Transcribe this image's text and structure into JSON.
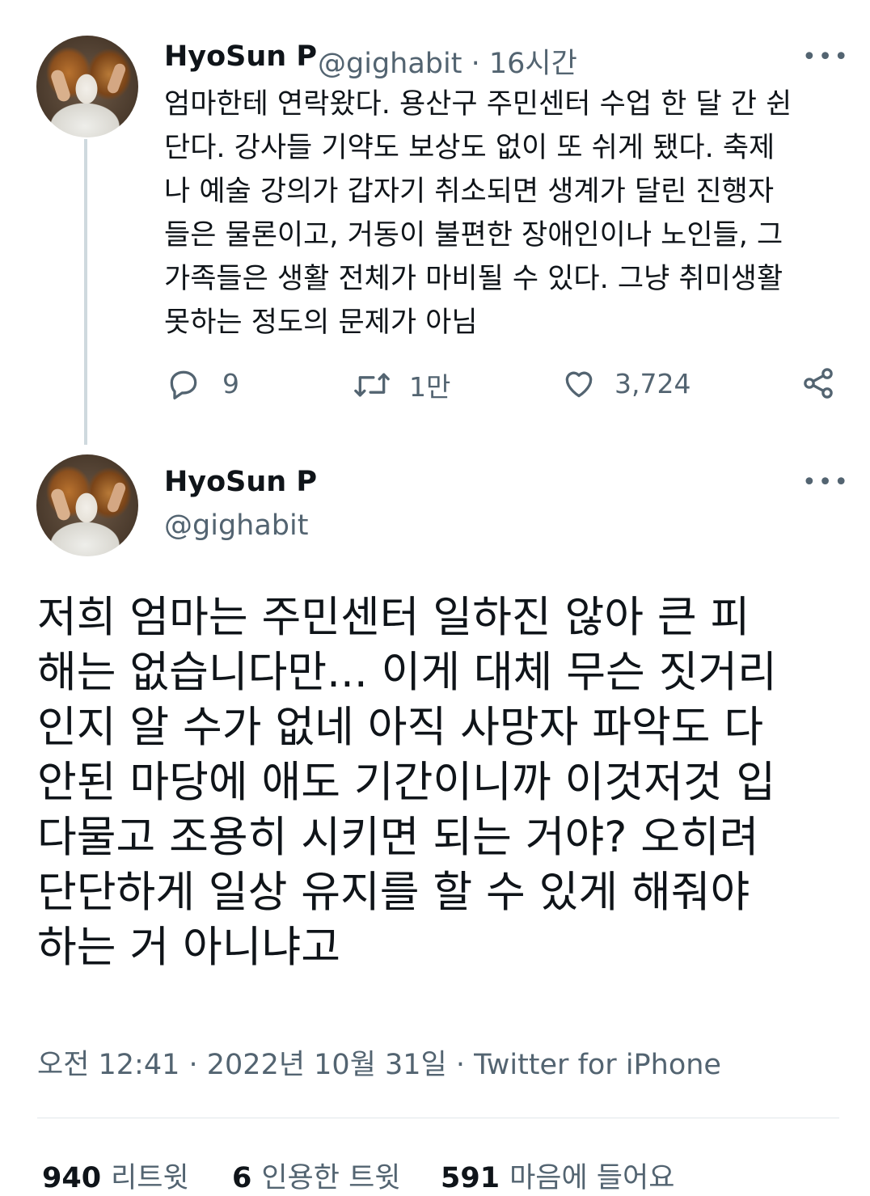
{
  "tweet1": {
    "display_name": "HyoSun P",
    "handle": "@gighabit",
    "separator": "·",
    "time": "16시간",
    "more_icon": "ellipsis-icon",
    "text_lines": [
      "엄마한테 연락왔다. 용산구 주민센터 수업 한 달 간 쉰",
      "단다. 강사들 기약도 보상도 없이 또 쉬게 됐다. 축제",
      "나 예술 강의가 갑자기 취소되면 생계가 달린 진행자",
      "들은 물론이고, 거동이 불편한 장애인이나 노인들, 그",
      "가족들은 생활 전체가 마비될 수 있다. 그냥 취미생활",
      "못하는 정도의 문제가 아님"
    ],
    "actions": {
      "reply": {
        "icon": "reply-icon",
        "count": "9"
      },
      "retweet": {
        "icon": "retweet-icon",
        "count": "1만"
      },
      "like": {
        "icon": "heart-icon",
        "count": "3,724"
      },
      "share": {
        "icon": "share-icon"
      }
    }
  },
  "tweet2": {
    "display_name": "HyoSun P",
    "handle": "@gighabit",
    "more_icon": "ellipsis-icon",
    "text_lines": [
      "저희 엄마는 주민센터 일하진 않아 큰 피",
      "해는 없습니다만... 이게 대체 무슨 짓거리",
      "인지 알 수가 없네 아직 사망자 파악도 다",
      "안된 마당에 애도 기간이니까 이것저것 입",
      "다물고 조용히 시키면 되는 거야? 오히려",
      "단단하게 일상 유지를 할 수 있게 해줘야",
      "하는 거 아니냐고"
    ],
    "timestamp": "오전 12:41 · 2022년 10월 31일 · Twitter for iPhone",
    "stats": {
      "retweets_count": "940",
      "retweets_label": "리트윗",
      "quotes_count": "6",
      "quotes_label": "인용한 트윗",
      "likes_count": "591",
      "likes_label": "마음에 들어요"
    }
  },
  "colors": {
    "text": "#0f1419",
    "secondary": "#536471",
    "thread_line": "#cfd9de",
    "divider": "#e1e6ea"
  }
}
